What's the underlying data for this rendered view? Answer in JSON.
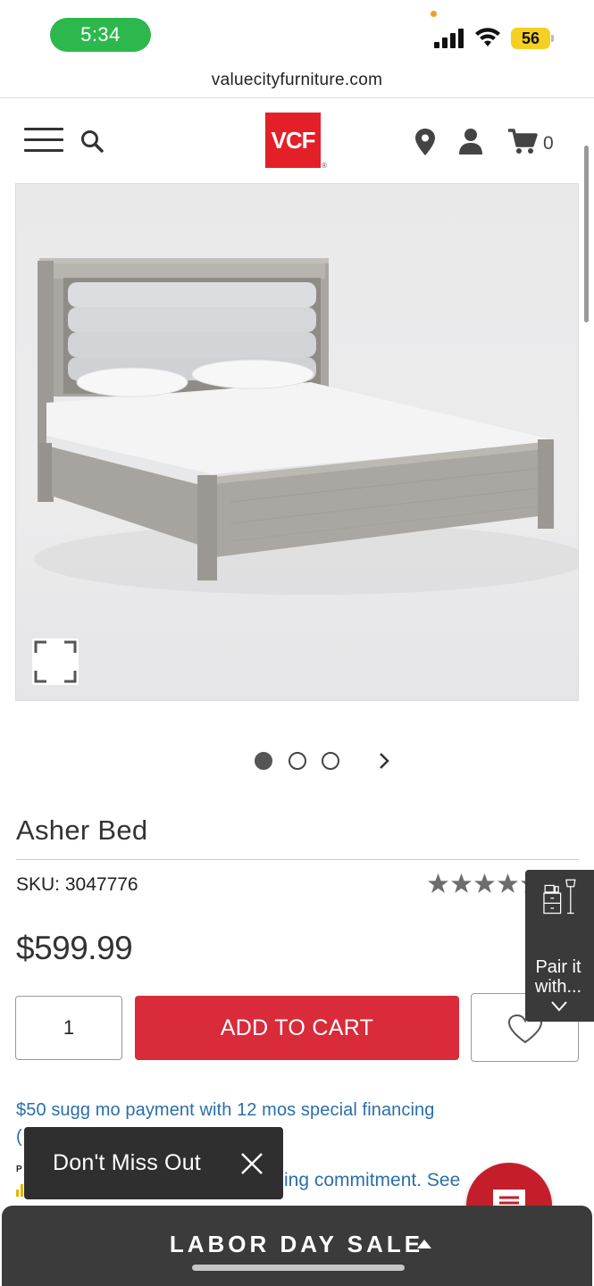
{
  "status_bar": {
    "time": "5:34",
    "battery": "56"
  },
  "browser": {
    "url": "valuecityfurniture.com"
  },
  "header": {
    "logo_text": "VCF",
    "logo_mark": "®",
    "cart_count": "0",
    "brand_color": "#e32027"
  },
  "product": {
    "title": "Asher Bed",
    "sku": "SKU: 3047776",
    "price": "$599.99",
    "rating_stars": 5,
    "quantity": "1",
    "add_to_cart_label": "ADD TO CART",
    "image_count": 3,
    "active_image": 1
  },
  "financing": {
    "line1": "$50 sugg mo payment with 12 mos special financing",
    "line2": "(",
    "line3": "ing commitment. See",
    "tiny_letter": "P"
  },
  "pair_widget": {
    "line1": "Pair it",
    "line2": "with..."
  },
  "toast": {
    "text": "Don't Miss Out"
  },
  "sale_bar": {
    "label": "LABOR DAY SALE"
  },
  "colors": {
    "accent_red": "#d92b3a",
    "link_blue": "#2a6fa8",
    "dark_panel": "#3b3b3b",
    "status_green": "#2db84d"
  }
}
